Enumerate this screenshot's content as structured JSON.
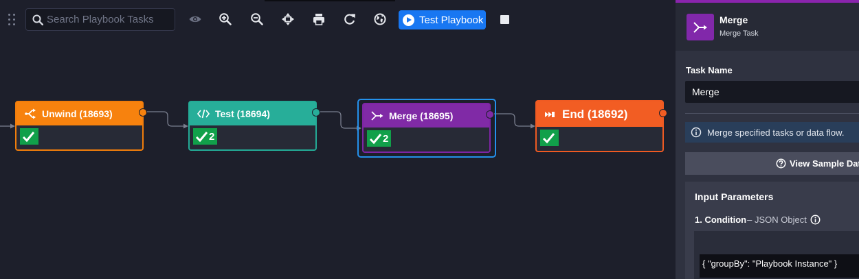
{
  "toolbar": {
    "search_placeholder": "Search Playbook Tasks",
    "icons": [
      "eye-icon",
      "zoom-in-icon",
      "zoom-out-icon",
      "fit-screen-icon",
      "print-icon",
      "refresh-icon",
      "globe-icon",
      "stop-icon"
    ],
    "test_playbook_label": "Test Playbook"
  },
  "canvas": {
    "nodes": [
      {
        "title": "Unwind (18693)",
        "icon": "unwind-icon",
        "color": "#f7820e",
        "status": "success",
        "count": ""
      },
      {
        "title": "Test (18694)",
        "icon": "code-icon",
        "color": "#27ae99",
        "status": "success",
        "count": "2"
      },
      {
        "title": "Merge (18695)",
        "icon": "merge-icon",
        "color": "#802aa6",
        "status": "success",
        "count": "2",
        "selected": true
      },
      {
        "title": "End (18692)",
        "icon": "end-icon",
        "color": "#f25d23",
        "status": "success",
        "count": ""
      }
    ]
  },
  "panel": {
    "accent": "#8a24ad",
    "title": "Merge",
    "subtitle": "Merge Task",
    "task_name_label": "Task Name",
    "task_name_value": "Merge",
    "info_text": "Merge specified tasks or data flow.",
    "sample_button_label": "View Sample Dat",
    "input_parameters": {
      "title": "Input Parameters",
      "condition_name": "1. Condition",
      "condition_type": "– JSON Object",
      "condition_value": "{ \"groupBy\": \"Playbook Instance\" }"
    }
  }
}
